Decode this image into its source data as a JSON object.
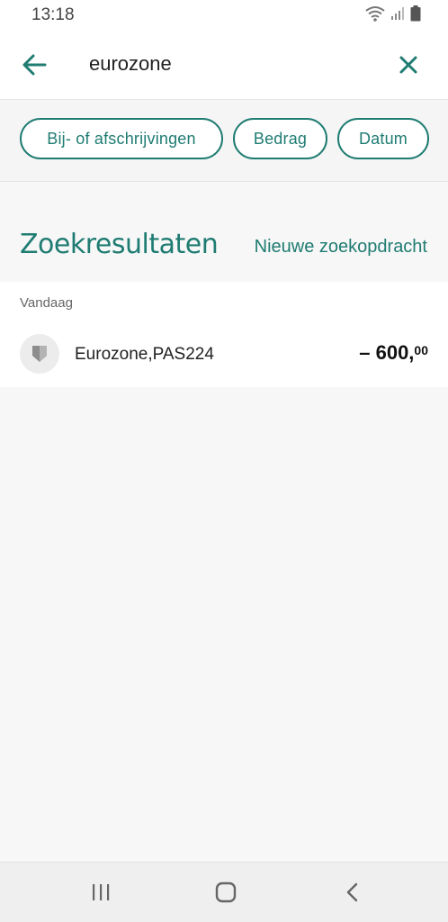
{
  "status": {
    "time": "13:18"
  },
  "search": {
    "query": "eurozone"
  },
  "filters": {
    "type_label": "Bij- of afschrijvingen",
    "amount_label": "Bedrag",
    "date_label": "Datum"
  },
  "results": {
    "title": "Zoekresultaten",
    "new_search_label": "Nieuwe zoekopdracht",
    "section_label": "Vandaag",
    "items": [
      {
        "name": "Eurozone,PAS224",
        "amount_main": "– 600,",
        "amount_cents": "00"
      }
    ]
  },
  "colors": {
    "accent": "#1f7c72",
    "background": "#f7f7f7"
  },
  "icons": {
    "back": "arrow-left-icon",
    "close": "close-icon",
    "avatar": "bank-shield-icon",
    "nav_recent": "recent-apps-icon",
    "nav_home": "home-icon",
    "nav_back": "back-chevron-icon"
  }
}
